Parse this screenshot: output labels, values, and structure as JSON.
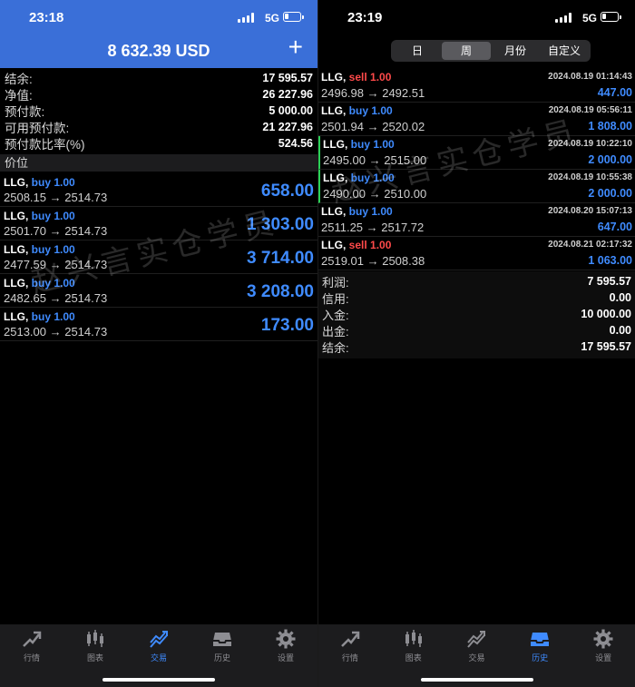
{
  "left": {
    "status": {
      "time": "23:18",
      "network": "5G"
    },
    "header": {
      "balance": "8 632.39 USD",
      "add_label": "+"
    },
    "summary": [
      {
        "label": "结余:",
        "value": "17 595.57"
      },
      {
        "label": "净值:",
        "value": "26 227.96"
      },
      {
        "label": "预付款:",
        "value": "5 000.00"
      },
      {
        "label": "可用预付款:",
        "value": "21 227.96"
      },
      {
        "label": "预付款比率(%)",
        "value": "524.56"
      }
    ],
    "section_title": "价位",
    "positions": [
      {
        "symbol": "LLG,",
        "side": "buy 1.00",
        "type": "buy",
        "prices": "2508.15 → 2514.73",
        "profit": "658.00"
      },
      {
        "symbol": "LLG,",
        "side": "buy 1.00",
        "type": "buy",
        "prices": "2501.70 → 2514.73",
        "profit": "1 303.00"
      },
      {
        "symbol": "LLG,",
        "side": "buy 1.00",
        "type": "buy",
        "prices": "2477.59 → 2514.73",
        "profit": "3 714.00"
      },
      {
        "symbol": "LLG,",
        "side": "buy 1.00",
        "type": "buy",
        "prices": "2482.65 → 2514.73",
        "profit": "3 208.00"
      },
      {
        "symbol": "LLG,",
        "side": "buy 1.00",
        "type": "buy",
        "prices": "2513.00 → 2514.73",
        "profit": "173.00"
      }
    ],
    "tabs": [
      {
        "label": "行情",
        "icon": "trend-arrow-icon",
        "active": false
      },
      {
        "label": "图表",
        "icon": "candlestick-icon",
        "active": false
      },
      {
        "label": "交易",
        "icon": "trade-chart-icon",
        "active": true
      },
      {
        "label": "历史",
        "icon": "inbox-icon",
        "active": false
      },
      {
        "label": "设置",
        "icon": "gear-icon",
        "active": false
      }
    ]
  },
  "right": {
    "status": {
      "time": "23:19",
      "network": "5G"
    },
    "segments": [
      {
        "label": "日",
        "active": false
      },
      {
        "label": "周",
        "active": true
      },
      {
        "label": "月份",
        "active": false
      },
      {
        "label": "自定义",
        "active": false
      }
    ],
    "deals": [
      {
        "symbol": "LLG,",
        "side": "sell 1.00",
        "type": "sell",
        "time": "2024.08.19 01:14:43",
        "prices": "2496.98 → 2492.51",
        "profit": "447.00",
        "marked": false
      },
      {
        "symbol": "LLG,",
        "side": "buy 1.00",
        "type": "buy",
        "time": "2024.08.19 05:56:11",
        "prices": "2501.94 → 2520.02",
        "profit": "1 808.00",
        "marked": false
      },
      {
        "symbol": "LLG,",
        "side": "buy 1.00",
        "type": "buy",
        "time": "2024.08.19 10:22:10",
        "prices": "2495.00 → 2515.00",
        "profit": "2 000.00",
        "marked": true
      },
      {
        "symbol": "LLG,",
        "side": "buy 1.00",
        "type": "buy",
        "time": "2024.08.19 10:55:38",
        "prices": "2490.00 → 2510.00",
        "profit": "2 000.00",
        "marked": true
      },
      {
        "symbol": "LLG,",
        "side": "buy 1.00",
        "type": "buy",
        "time": "2024.08.20 15:07:13",
        "prices": "2511.25 → 2517.72",
        "profit": "647.00",
        "marked": false
      },
      {
        "symbol": "LLG,",
        "side": "sell 1.00",
        "type": "sell",
        "time": "2024.08.21 02:17:32",
        "prices": "2519.01 → 2508.38",
        "profit": "1 063.00",
        "marked": false
      }
    ],
    "totals": [
      {
        "label": "利润:",
        "value": "7 595.57"
      },
      {
        "label": "信用:",
        "value": "0.00"
      },
      {
        "label": "入金:",
        "value": "10 000.00"
      },
      {
        "label": "出金:",
        "value": "0.00"
      },
      {
        "label": "结余:",
        "value": "17 595.57"
      }
    ],
    "tabs": [
      {
        "label": "行情",
        "icon": "trend-arrow-icon",
        "active": false
      },
      {
        "label": "图表",
        "icon": "candlestick-icon",
        "active": false
      },
      {
        "label": "交易",
        "icon": "trade-chart-icon",
        "active": false
      },
      {
        "label": "历史",
        "icon": "inbox-icon",
        "active": true
      },
      {
        "label": "设置",
        "icon": "gear-icon",
        "active": false
      }
    ]
  },
  "watermark": "赵兴言实仓学员",
  "colors": {
    "header_blue": "#3a6fd8",
    "buy_blue": "#3f8bff",
    "sell_red": "#ff4a4a",
    "mark_green": "#2bd157"
  }
}
